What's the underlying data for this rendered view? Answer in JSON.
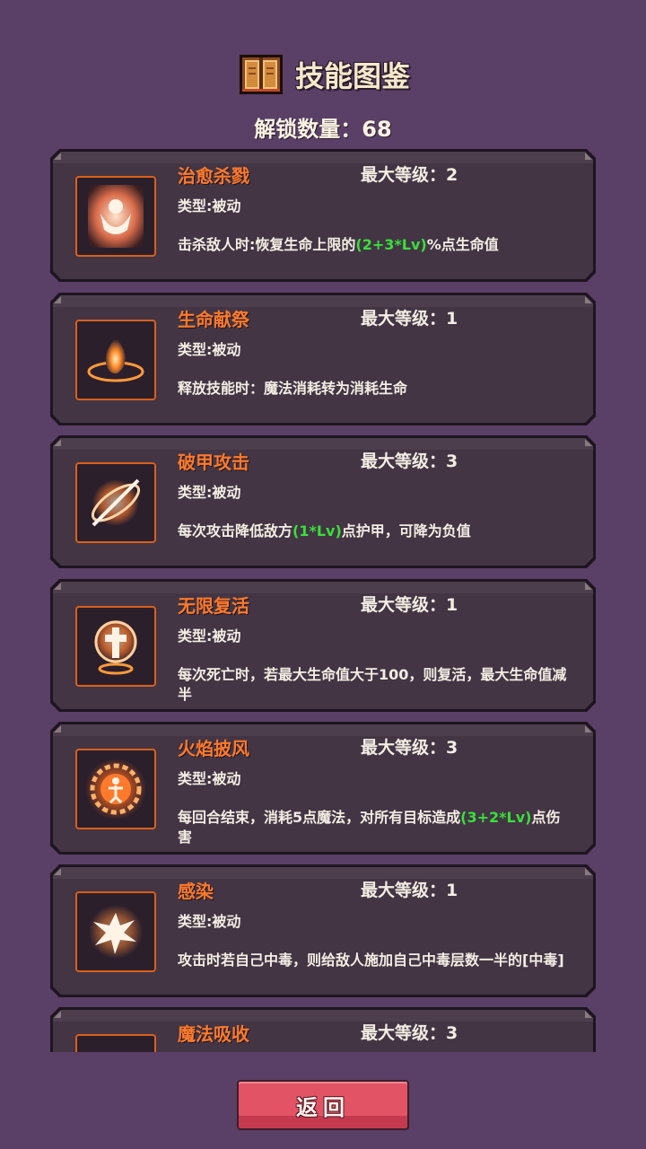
{
  "header": {
    "title": "技能图鉴",
    "icon": "book-icon"
  },
  "unlock_text": "解锁数量：68",
  "skills": [
    {
      "name": "治愈杀戮",
      "max_level": "最大等级：2",
      "type": "类型:被动",
      "desc_parts": [
        {
          "t": "击杀敌人时:恢复生命上限的",
          "hl": false
        },
        {
          "t": "(2+3*Lv)",
          "hl": true
        },
        {
          "t": "%点生命值",
          "hl": false
        }
      ],
      "icon": "healing-kill-icon"
    },
    {
      "name": "生命献祭",
      "max_level": "最大等级：1",
      "type": "类型:被动",
      "desc_parts": [
        {
          "t": "释放技能时：魔法消耗转为消耗生命",
          "hl": false
        }
      ],
      "icon": "flame-sacrifice-icon"
    },
    {
      "name": "破甲攻击",
      "max_level": "最大等级：3",
      "type": "类型:被动",
      "desc_parts": [
        {
          "t": "每次攻击降低敌方",
          "hl": false
        },
        {
          "t": "(1*Lv)",
          "hl": true
        },
        {
          "t": "点护甲，可降为负值",
          "hl": false
        }
      ],
      "icon": "armor-break-icon"
    },
    {
      "name": "无限复活",
      "max_level": "最大等级：1",
      "type": "类型:被动",
      "desc_parts": [
        {
          "t": "每次死亡时，若最大生命值大于100，则复活，最大生命值减半",
          "hl": false
        }
      ],
      "icon": "cross-revive-icon"
    },
    {
      "name": "火焰披风",
      "max_level": "最大等级：3",
      "type": "类型:被动",
      "desc_parts": [
        {
          "t": "每回合结束，消耗5点魔法，对所有目标造成",
          "hl": false
        },
        {
          "t": "(3+2*Lv)",
          "hl": true
        },
        {
          "t": "点伤害",
          "hl": false
        }
      ],
      "icon": "fire-cloak-icon"
    },
    {
      "name": "感染",
      "max_level": "最大等级：1",
      "type": "类型:被动",
      "desc_parts": [
        {
          "t": "攻击时若自己中毒，则给敌人施加自己中毒层数一半的[中毒]",
          "hl": false
        }
      ],
      "icon": "infection-splash-icon"
    },
    {
      "name": "魔法吸收",
      "max_level": "最大等级：3",
      "type": "",
      "desc_parts": [],
      "icon": "magic-absorb-icon"
    }
  ],
  "back_button": "返回",
  "colors": {
    "background": "#5a3f66",
    "card": "#433544",
    "skill_name": "#ff7a2c",
    "highlight": "#38e03a",
    "button": "#e25465"
  }
}
